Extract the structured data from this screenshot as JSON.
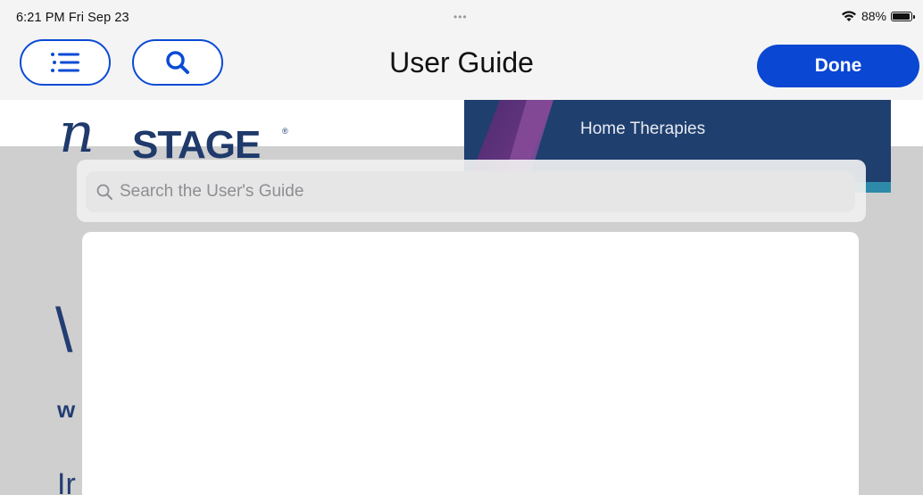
{
  "status": {
    "time": "6:21 PM  Fri Sep 23",
    "dots": "•••",
    "battery_percent": "88%"
  },
  "nav": {
    "title": "User Guide",
    "done_label": "Done",
    "menu_icon": "list-icon",
    "search_icon": "search-icon"
  },
  "brand": {
    "logo_text": "STAGE",
    "logo_reg": "®",
    "banner_text": "Home Therapies"
  },
  "background_text": {
    "char1": "\\",
    "char2": "w",
    "char3": "Ir"
  },
  "search": {
    "placeholder": "Search the User's Guide"
  },
  "colors": {
    "accent": "#0a47d2",
    "brand_navy": "#1f3a6b"
  }
}
